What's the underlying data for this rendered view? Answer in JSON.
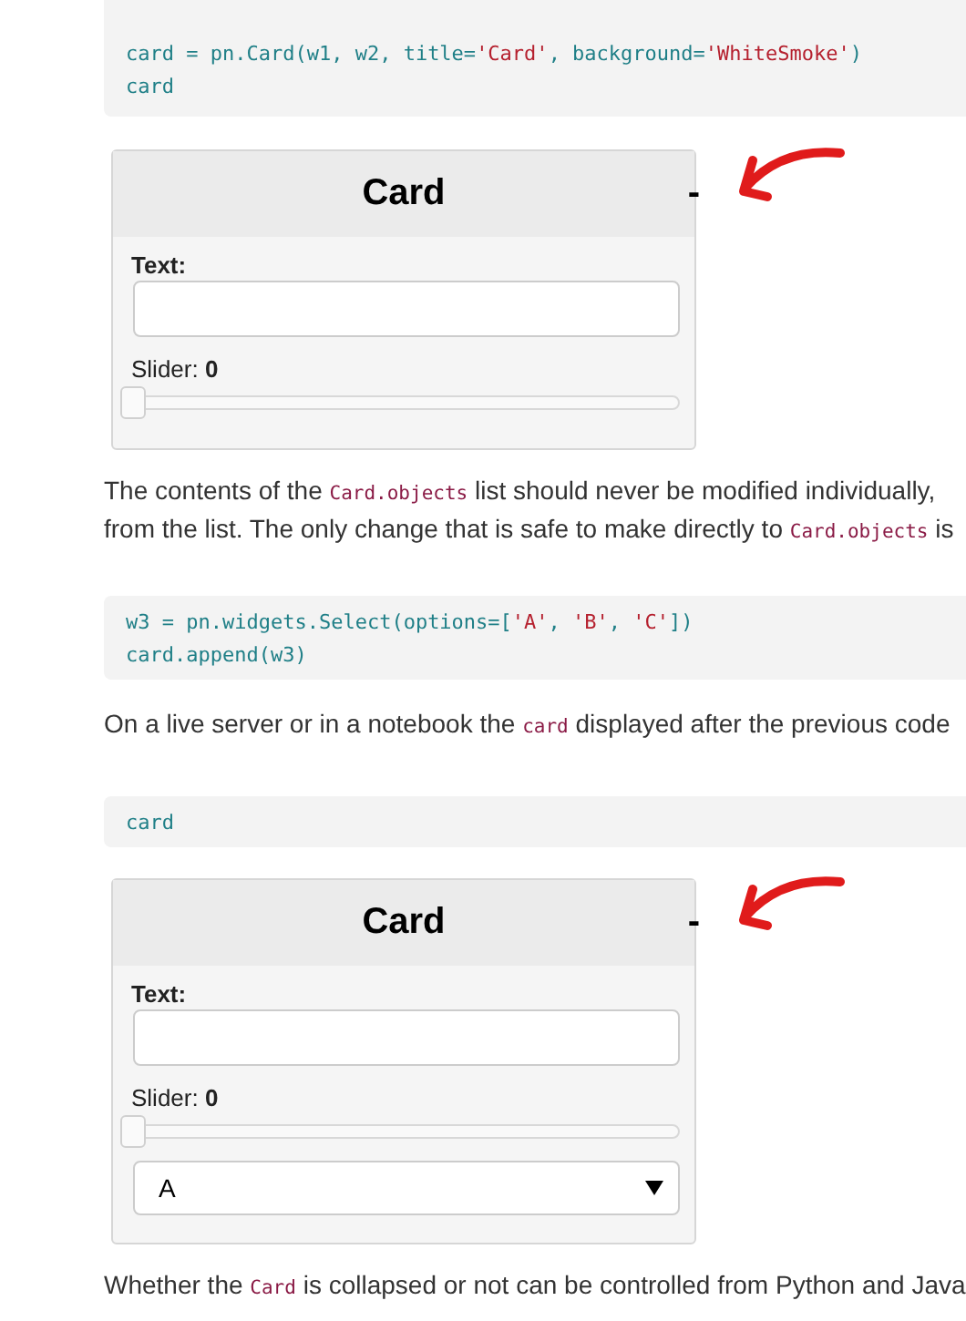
{
  "blocks": [
    {
      "kind": "code",
      "lines": [
        [
          {
            "kind": "name",
            "text": "card = pn.Card(w1, w2, title="
          },
          {
            "kind": "string",
            "text": "'Card'"
          },
          {
            "kind": "name",
            "text": ", background="
          },
          {
            "kind": "string",
            "text": "'WhiteSmoke'"
          },
          {
            "kind": "name",
            "text": ")"
          }
        ],
        [
          {
            "kind": "name",
            "text": "card"
          }
        ]
      ]
    },
    {
      "kind": "card",
      "title": "Card",
      "collapse": "-",
      "annotated": true,
      "widgets": [
        {
          "kind": "text",
          "label": "Text:"
        },
        {
          "kind": "slider",
          "label": "Slider: **0**",
          "level": 0
        }
      ]
    },
    {
      "kind": "paragraph",
      "lines": [
        [
          {
            "kind": "text",
            "text": "The contents of the "
          },
          {
            "kind": "code",
            "text": "Card.objects"
          },
          {
            "kind": "text",
            "text": " list should never be modified individually,"
          }
        ],
        [
          {
            "kind": "text",
            "text": "from the list. The only change that is safe to make directly to "
          },
          {
            "kind": "code",
            "text": "Card.objects"
          },
          {
            "kind": "text",
            "text": " is"
          }
        ]
      ]
    },
    {
      "kind": "code",
      "lines": [
        [
          {
            "kind": "name",
            "text": "w3 = pn.widgets.Select(options=["
          },
          {
            "kind": "string",
            "text": "'A'"
          },
          {
            "kind": "name",
            "text": ", "
          },
          {
            "kind": "string",
            "text": "'B'"
          },
          {
            "kind": "name",
            "text": ", "
          },
          {
            "kind": "string",
            "text": "'C'"
          },
          {
            "kind": "name",
            "text": "])"
          }
        ],
        [
          {
            "kind": "name",
            "text": "card.append(w3)"
          }
        ]
      ]
    },
    {
      "kind": "paragraph",
      "lines": [
        [
          {
            "kind": "text",
            "text": "On a live server or in a notebook the "
          },
          {
            "kind": "code",
            "text": "card"
          },
          {
            "kind": "text",
            "text": " displayed after the previous code"
          }
        ]
      ]
    },
    {
      "kind": "code",
      "lines": [
        [
          {
            "kind": "name",
            "text": "card"
          }
        ]
      ]
    },
    {
      "kind": "card",
      "title": "Card",
      "collapse": "-",
      "annotated": true,
      "widgets": [
        {
          "kind": "text",
          "label": "Text:"
        },
        {
          "kind": "slider",
          "label": "Slider: **0**",
          "level": 0
        },
        {
          "kind": "select",
          "value": "A"
        }
      ]
    },
    {
      "kind": "paragraph",
      "lines": [
        [
          {
            "kind": "text",
            "text": "Whether the "
          },
          {
            "kind": "code",
            "text": "Card"
          },
          {
            "kind": "text",
            "text": " is collapsed or not can be controlled from Python and Java"
          }
        ]
      ]
    }
  ]
}
